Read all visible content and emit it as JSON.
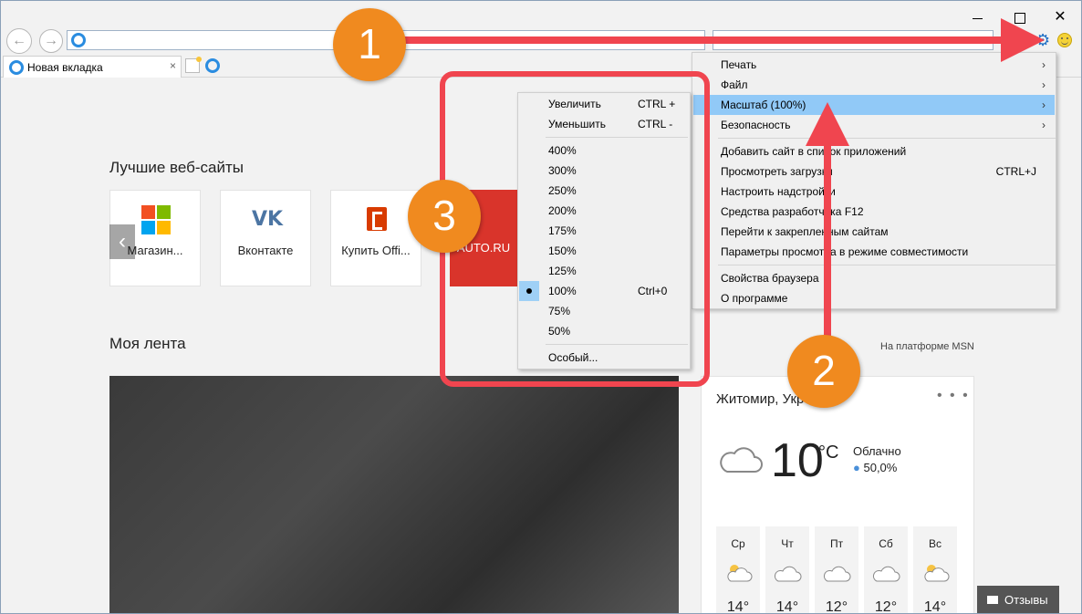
{
  "window": {
    "minimize_icon": "minimize-icon",
    "maximize_icon": "maximize-icon",
    "close_glyph": "✕"
  },
  "nav": {
    "back_glyph": "←",
    "forward_glyph": "→",
    "address_value": ""
  },
  "tab": {
    "label": "Новая вкладка",
    "close_glyph": "×"
  },
  "tools_menu": {
    "items": [
      {
        "label": "Печать",
        "has_submenu": true
      },
      {
        "label": "Файл",
        "has_submenu": true
      },
      {
        "label": "Масштаб (100%)",
        "has_submenu": true,
        "highlighted": true
      },
      {
        "label": "Безопасность",
        "has_submenu": true
      },
      {
        "label": "Добавить сайт в список приложений"
      },
      {
        "label": "Просмотреть загрузки",
        "shortcut": "CTRL+J"
      },
      {
        "label": "Настроить надстройки"
      },
      {
        "label": "Средства разработчика F12"
      },
      {
        "label": "Перейти к закрепленным сайтам"
      },
      {
        "label": "Параметры просмотра в режиме совместимости"
      },
      {
        "label": "Свойства браузера"
      },
      {
        "label": "О программе"
      }
    ],
    "submenu_arrow": "›"
  },
  "zoom_menu": {
    "zoom_in": {
      "label": "Увеличить",
      "shortcut": "CTRL +"
    },
    "zoom_out": {
      "label": "Уменьшить",
      "shortcut": "CTRL -"
    },
    "levels": [
      "400%",
      "300%",
      "250%",
      "200%",
      "175%",
      "150%",
      "125%",
      "100%",
      "75%",
      "50%"
    ],
    "selected": "100%",
    "selected_shortcut": "Ctrl+0",
    "custom": "Особый..."
  },
  "top_sites": {
    "title": "Лучшие веб-сайты",
    "tiles": [
      {
        "label": "Магазин...",
        "icon": "windows-store-icon"
      },
      {
        "label": "Вконтакте",
        "icon": "vk-icon"
      },
      {
        "label": "Купить Offi...",
        "icon": "office-icon"
      },
      {
        "label": "AUTO.RU",
        "icon": "auto-ru-icon",
        "color": "#d9342b"
      }
    ]
  },
  "feed": {
    "title": "Моя лента",
    "provider": "На платформе MSN",
    "prev_glyph": "‹",
    "next_glyph": "›"
  },
  "weather": {
    "city": "Житомир, Укр",
    "more": "• • •",
    "temp": "10",
    "unit": "°C",
    "condition": "Облачно",
    "humidity": "50,0%",
    "forecast": [
      {
        "day": "Ср",
        "temp": "14°",
        "icon": "partly-sunny-icon"
      },
      {
        "day": "Чт",
        "temp": "14°",
        "icon": "cloud-icon"
      },
      {
        "day": "Пт",
        "temp": "12°",
        "icon": "cloud-icon"
      },
      {
        "day": "Сб",
        "temp": "12°",
        "icon": "cloud-icon"
      },
      {
        "day": "Вс",
        "temp": "14°",
        "icon": "partly-sunny-icon"
      }
    ]
  },
  "feedback": {
    "label": "Отзывы"
  },
  "annotations": {
    "badge1": "1",
    "badge2": "2",
    "badge3": "3",
    "accent_color": "#f0454f",
    "badge_color": "#f08a1f"
  }
}
